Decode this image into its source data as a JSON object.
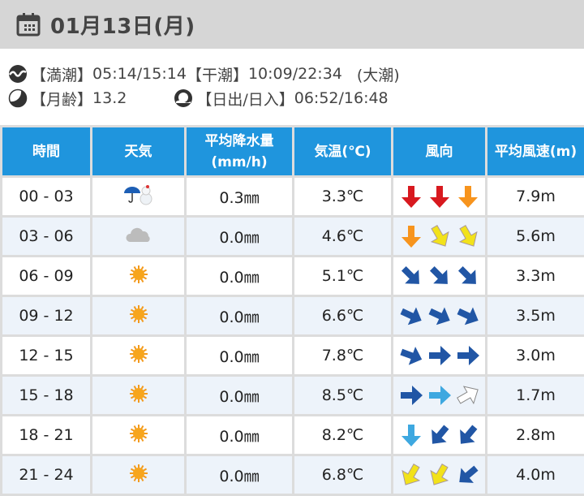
{
  "header": {
    "date": "01月13日(月)",
    "icon": "calendar-icon"
  },
  "tide": {
    "high_label": "【満潮】",
    "high": "05:14/15:14",
    "low_label": "【干潮】",
    "low": "10:09/22:34",
    "type": "(大潮)"
  },
  "moon": {
    "label": "【月齢】",
    "value": "13.2"
  },
  "sun": {
    "label": "【日出/日入】",
    "value": "06:52/16:48"
  },
  "columns": [
    "時間",
    "天気",
    "平均降水量\n(mm/h)",
    "気温(℃)",
    "風向",
    "平均風速(m)"
  ],
  "colors": {
    "red": "#d8191f",
    "orange": "#f7941d",
    "yellow": "#f2e21a",
    "navy": "#2156a5",
    "lightblue": "#3ea8e0",
    "white": "#ffffff",
    "header": "#1f95dd"
  },
  "rows": [
    {
      "time": "00 - 03",
      "weather": "rain-snow",
      "precip": "0.3㎜",
      "temp": "3.3℃",
      "wind": [
        [
          "red",
          90
        ],
        [
          "red",
          90
        ],
        [
          "orange",
          90
        ]
      ],
      "speed": "7.9m"
    },
    {
      "time": "03 - 06",
      "weather": "cloudy",
      "precip": "0.0㎜",
      "temp": "4.6℃",
      "wind": [
        [
          "orange",
          90
        ],
        [
          "yellow",
          60
        ],
        [
          "yellow",
          60
        ]
      ],
      "speed": "5.6m"
    },
    {
      "time": "06 - 09",
      "weather": "sunny",
      "precip": "0.0㎜",
      "temp": "5.1℃",
      "wind": [
        [
          "navy",
          45
        ],
        [
          "navy",
          45
        ],
        [
          "navy",
          45
        ]
      ],
      "speed": "3.3m"
    },
    {
      "time": "09 - 12",
      "weather": "sunny",
      "precip": "0.0㎜",
      "temp": "6.6℃",
      "wind": [
        [
          "navy",
          25
        ],
        [
          "navy",
          25
        ],
        [
          "navy",
          25
        ]
      ],
      "speed": "3.5m"
    },
    {
      "time": "12 - 15",
      "weather": "sunny",
      "precip": "0.0㎜",
      "temp": "7.8℃",
      "wind": [
        [
          "navy",
          20
        ],
        [
          "navy",
          0
        ],
        [
          "navy",
          0
        ]
      ],
      "speed": "3.0m"
    },
    {
      "time": "15 - 18",
      "weather": "sunny",
      "precip": "0.0㎜",
      "temp": "8.5℃",
      "wind": [
        [
          "navy",
          0
        ],
        [
          "lightblue",
          0
        ],
        [
          "white",
          -30
        ]
      ],
      "speed": "1.7m"
    },
    {
      "time": "18 - 21",
      "weather": "sunny",
      "precip": "0.0㎜",
      "temp": "8.2℃",
      "wind": [
        [
          "lightblue",
          90
        ],
        [
          "navy",
          130
        ],
        [
          "navy",
          130
        ]
      ],
      "speed": "2.8m"
    },
    {
      "time": "21 - 24",
      "weather": "sunny",
      "precip": "0.0㎜",
      "temp": "6.8℃",
      "wind": [
        [
          "yellow",
          120
        ],
        [
          "yellow",
          120
        ],
        [
          "navy",
          140
        ]
      ],
      "speed": "4.0m"
    }
  ]
}
